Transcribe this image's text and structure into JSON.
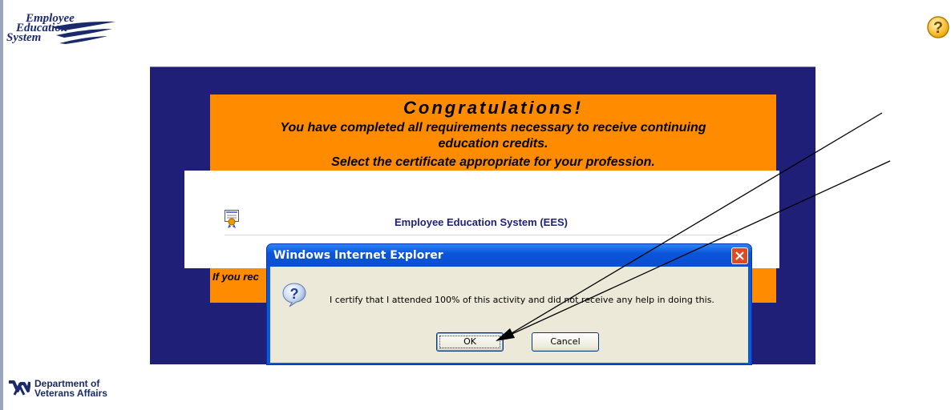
{
  "header": {
    "logo_line1": "Employee",
    "logo_line2": "Education",
    "logo_line3": "System"
  },
  "help": {
    "icon": "question-mark-icon"
  },
  "banner": {
    "title": "Congratulations!",
    "line1": "You have completed all requirements necessary to receive continuing",
    "line2": "education credits.",
    "line3": "Select the certificate appropriate for your profession.",
    "bottom_text": "If you rec"
  },
  "certificates": [
    {
      "icon": "certificate-icon",
      "label": "Employee Education System (EES)"
    }
  ],
  "dialog": {
    "title": "Windows Internet Explorer",
    "message": "I certify that I attended 100% of this activity and did not receive any help in doing this.",
    "ok_label": "OK",
    "cancel_label": "Cancel"
  },
  "footer": {
    "va_line1": "Department of",
    "va_line2": "Veterans Affairs"
  },
  "colors": {
    "panel": "#1f1f78",
    "banner": "#ff8c00",
    "dialog_titlebar": "#0a55d8",
    "dialog_body": "#ece9d8"
  }
}
